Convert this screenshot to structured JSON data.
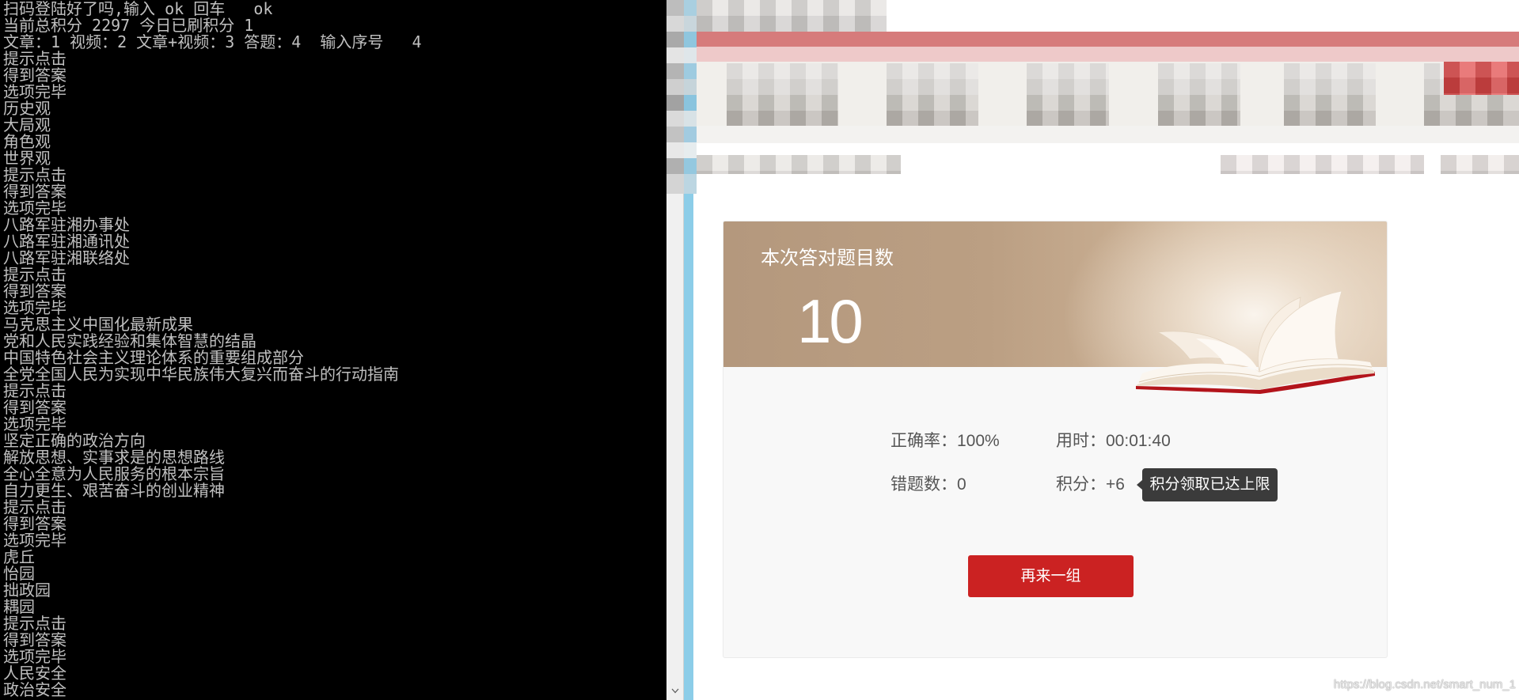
{
  "console": {
    "lines": [
      "扫码登陆好了吗,输入 ok 回车   ok",
      "当前总积分 2297 今日已刷积分 1",
      "文章：1 视频：2 文章+视频：3 答题：4  输入序号   4",
      "提示点击",
      "得到答案",
      "选项完毕",
      "历史观",
      "大局观",
      "角色观",
      "世界观",
      "提示点击",
      "得到答案",
      "选项完毕",
      "八路军驻湘办事处",
      "八路军驻湘通讯处",
      "八路军驻湘联络处",
      "提示点击",
      "得到答案",
      "选项完毕",
      "马克思主义中国化最新成果",
      "党和人民实践经验和集体智慧的结晶",
      "中国特色社会主义理论体系的重要组成部分",
      "全党全国人民为实现中华民族伟大复兴而奋斗的行动指南",
      "提示点击",
      "得到答案",
      "选项完毕",
      "坚定正确的政治方向",
      "解放思想、实事求是的思想路线",
      "全心全意为人民服务的根本宗旨",
      "自力更生、艰苦奋斗的创业精神",
      "提示点击",
      "得到答案",
      "选项完毕",
      "虎丘",
      "怡园",
      "拙政园",
      "耦园",
      "提示点击",
      "得到答案",
      "选项完毕",
      "人民安全",
      "政治安全"
    ]
  },
  "quiz_result": {
    "title": "本次答对题目数",
    "correct_count": "10",
    "accuracy": {
      "label": "正确率：",
      "value": "100%"
    },
    "time_used": {
      "label": "用时：",
      "value": "00:01:40"
    },
    "wrong_count": {
      "label": "错题数：",
      "value": "0"
    },
    "points": {
      "label": "积分：",
      "value": "+6"
    },
    "points_tooltip": "积分领取已达上限",
    "retry_button": "再来一组"
  },
  "watermark": "https://blog.csdn.net/smart_num_1",
  "icons": {
    "console_scroll_down": "chevron-down-icon",
    "result_illustration": "open-book-icon"
  },
  "colors": {
    "console_bg": "#000000",
    "console_text": "#c0c0c0",
    "window_border_blue": "#8ccde8",
    "header_brown": "#b4987d",
    "accent_red": "#cb2222",
    "tooltip_bg": "#3b3b3b",
    "stat_text": "#555555"
  }
}
